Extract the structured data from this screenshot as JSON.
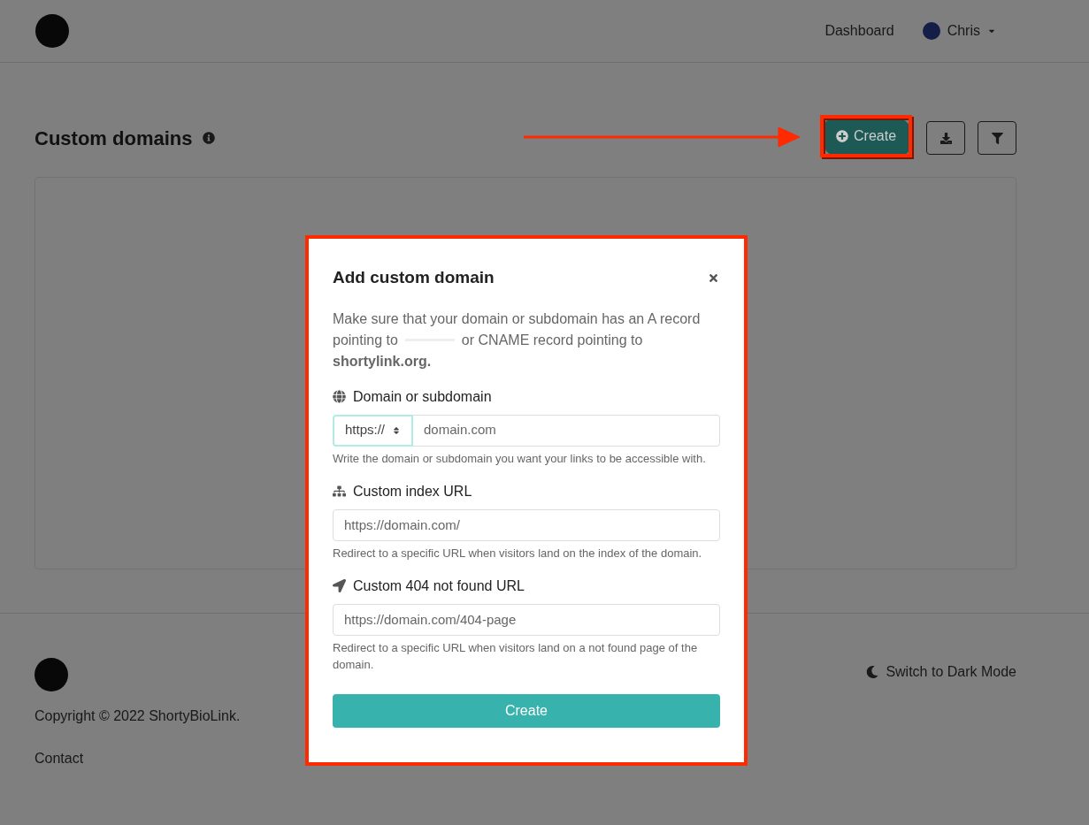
{
  "navbar": {
    "links": [
      {
        "label": "Dashboard"
      }
    ],
    "user": {
      "name": "Chris"
    }
  },
  "page": {
    "title": "Custom domains",
    "actions": [
      {
        "kind": "create",
        "label": "Create"
      },
      {
        "kind": "download"
      },
      {
        "kind": "filter"
      }
    ]
  },
  "footer": {
    "copyright": "Copyright © 2022 ShortyBioLink.",
    "links": [
      "Contact"
    ],
    "theme_toggle": "Switch to Dark Mode"
  },
  "modal": {
    "title": "Add custom domain",
    "description": {
      "line_1": "Make sure that your domain or subdomain has an A record",
      "line_2_start": "pointing to",
      "line_2_end": "or CNAME record pointing to",
      "line_3": "shortylink.org."
    },
    "fields": [
      {
        "kind": "domain",
        "label": "Domain or subdomain",
        "scheme": "https://",
        "placeholder": "domain.com",
        "help": "Write the domain or subdomain you want your links to be accessible with."
      },
      {
        "kind": "index",
        "label": "Custom index URL",
        "placeholder": "https://domain.com/",
        "help": "Redirect to a specific URL when visitors land on the index of the domain."
      },
      {
        "kind": "notfound",
        "label": "Custom 404 not found URL",
        "placeholder": "https://domain.com/404-page",
        "help": "Redirect to a specific URL when visitors land on a not found page of the domain."
      }
    ],
    "submit": "Create"
  }
}
